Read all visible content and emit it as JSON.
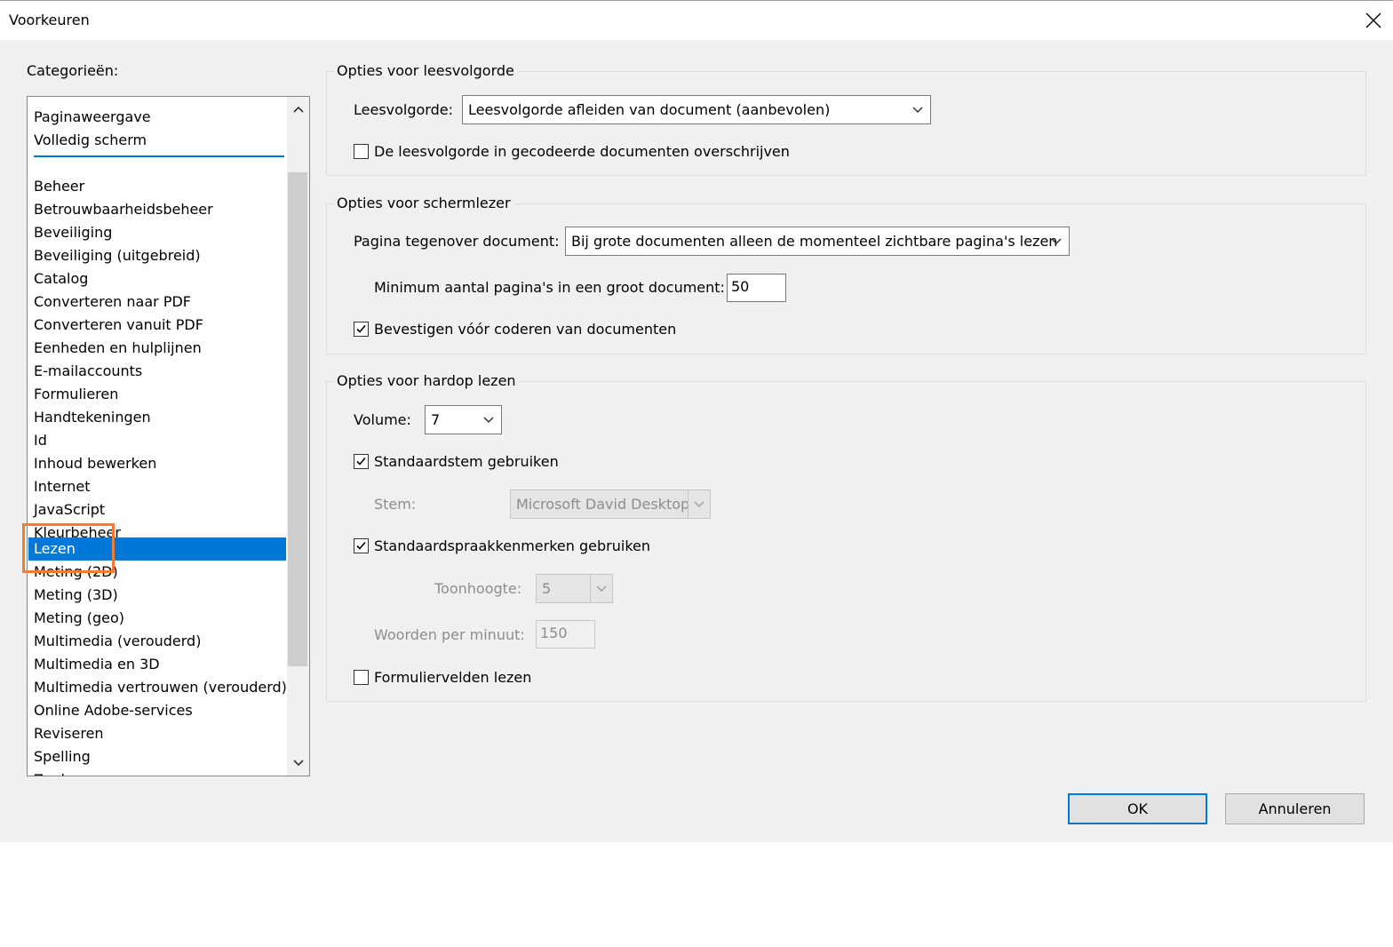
{
  "window": {
    "title": "Voorkeuren"
  },
  "categories": {
    "label": "Categorieën:",
    "items": [
      "Paginaweergave",
      "Volledig scherm",
      "Beheer",
      "Betrouwbaarheidsbeheer",
      "Beveiliging",
      "Beveiliging (uitgebreid)",
      "Catalog",
      "Converteren naar PDF",
      "Converteren vanuit PDF",
      "Eenheden en hulplijnen",
      "E-mailaccounts",
      "Formulieren",
      "Handtekeningen",
      "Id",
      "Inhoud bewerken",
      "Internet",
      "JavaScript",
      "Kleurbeheer",
      "Lezen",
      "Meting (2D)",
      "Meting (3D)",
      "Meting (geo)",
      "Multimedia (verouderd)",
      "Multimedia en 3D",
      "Multimedia vertrouwen (verouderd)",
      "Online Adobe-services",
      "Reviseren",
      "Spelling",
      "Zoeken"
    ],
    "selected": "Lezen"
  },
  "reading_order": {
    "legend": "Opties voor leesvolgorde",
    "order_label": "Leesvolgorde:",
    "order_value": "Leesvolgorde afleiden van document (aanbevolen)",
    "override_label": "De leesvolgorde in gecodeerde documenten overschrijven",
    "override_checked": false
  },
  "screen_reader": {
    "legend": "Opties voor schermlezer",
    "page_vs_doc_label": "Pagina tegenover document:",
    "page_vs_doc_value": "Bij grote documenten alleen de momenteel zichtbare pagina's lezen",
    "min_pages_label": "Minimum aantal pagina's in een groot document:",
    "min_pages_value": "50",
    "confirm_label": "Bevestigen vóór coderen van documenten",
    "confirm_checked": true
  },
  "read_aloud": {
    "legend": "Opties voor hardop lezen",
    "volume_label": "Volume:",
    "volume_value": "7",
    "default_voice_label": "Standaardstem gebruiken",
    "default_voice_checked": true,
    "voice_label": "Stem:",
    "voice_value": "Microsoft David Desktop",
    "default_speech_label": "Standaardspraakkenmerken gebruiken",
    "default_speech_checked": true,
    "pitch_label": "Toonhoogte:",
    "pitch_value": "5",
    "wpm_label": "Woorden per minuut:",
    "wpm_value": "150",
    "form_fields_label": "Formuliervelden lezen",
    "form_fields_checked": false
  },
  "buttons": {
    "ok": "OK",
    "cancel": "Annuleren"
  },
  "colors": {
    "selection": "#0078d7",
    "highlight_box": "#ef7e3a",
    "dialog_bg": "#f0f0f0"
  }
}
